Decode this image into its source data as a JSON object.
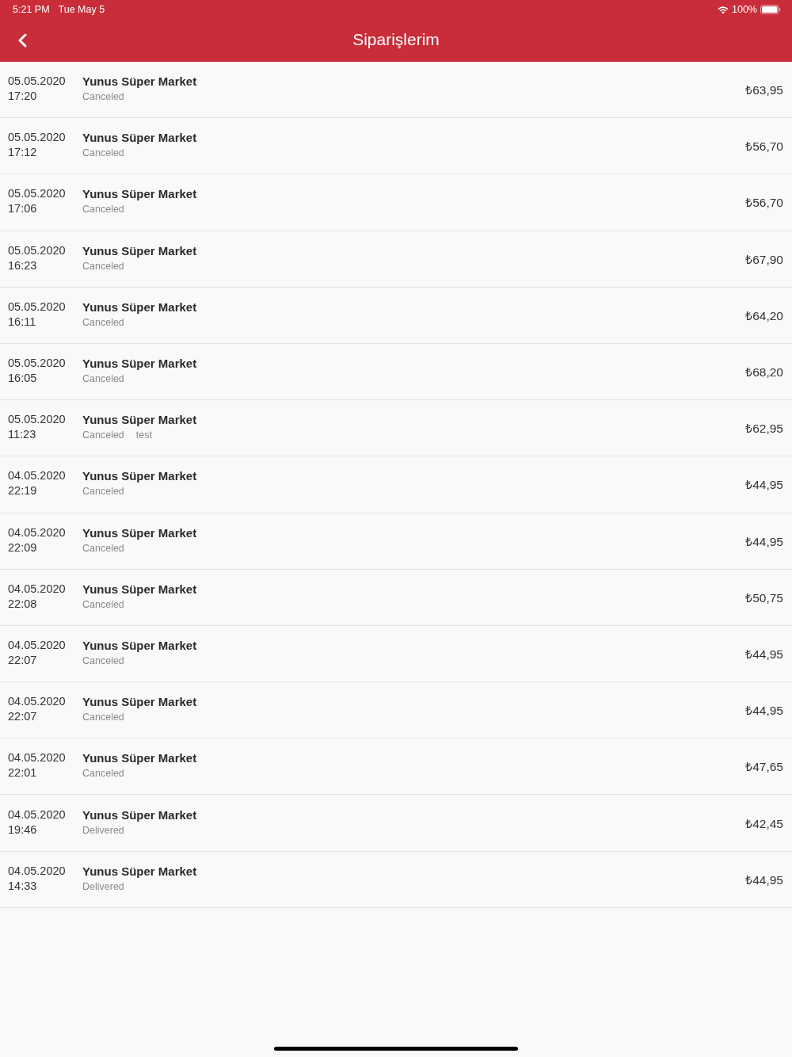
{
  "status_bar": {
    "time": "5:21 PM",
    "date": "Tue May 5",
    "battery": "100%"
  },
  "nav_bar": {
    "title": "Siparişlerim"
  },
  "orders": [
    {
      "date": "05.05.2020",
      "time": "17:20",
      "store": "Yunus Süper Market",
      "status": "Canceled",
      "price": "₺63,95"
    },
    {
      "date": "05.05.2020",
      "time": "17:12",
      "store": "Yunus Süper Market",
      "status": "Canceled",
      "price": "₺56,70"
    },
    {
      "date": "05.05.2020",
      "time": "17:06",
      "store": "Yunus Süper Market",
      "status": "Canceled",
      "price": "₺56,70"
    },
    {
      "date": "05.05.2020",
      "time": "16:23",
      "store": "Yunus Süper Market",
      "status": "Canceled",
      "price": "₺67,90"
    },
    {
      "date": "05.05.2020",
      "time": "16:11",
      "store": "Yunus Süper Market",
      "status": "Canceled",
      "price": "₺64,20"
    },
    {
      "date": "05.05.2020",
      "time": "16:05",
      "store": "Yunus Süper Market",
      "status": "Canceled",
      "price": "₺68,20"
    },
    {
      "date": "05.05.2020",
      "time": "11:23",
      "store": "Yunus Süper Market",
      "status": "Canceled",
      "note": "test",
      "price": "₺62,95"
    },
    {
      "date": "04.05.2020",
      "time": "22:19",
      "store": "Yunus Süper Market",
      "status": "Canceled",
      "price": "₺44,95"
    },
    {
      "date": "04.05.2020",
      "time": "22:09",
      "store": "Yunus Süper Market",
      "status": "Canceled",
      "price": "₺44,95"
    },
    {
      "date": "04.05.2020",
      "time": "22:08",
      "store": "Yunus Süper Market",
      "status": "Canceled",
      "price": "₺50,75"
    },
    {
      "date": "04.05.2020",
      "time": "22:07",
      "store": "Yunus Süper Market",
      "status": "Canceled",
      "price": "₺44,95"
    },
    {
      "date": "04.05.2020",
      "time": "22:07",
      "store": "Yunus Süper Market",
      "status": "Canceled",
      "price": "₺44,95"
    },
    {
      "date": "04.05.2020",
      "time": "22:01",
      "store": "Yunus Süper Market",
      "status": "Canceled",
      "price": "₺47,65"
    },
    {
      "date": "04.05.2020",
      "time": "19:46",
      "store": "Yunus Süper Market",
      "status": "Delivered",
      "price": "₺42,45"
    },
    {
      "date": "04.05.2020",
      "time": "14:33",
      "store": "Yunus Süper Market",
      "status": "Delivered",
      "price": "₺44,95"
    }
  ]
}
